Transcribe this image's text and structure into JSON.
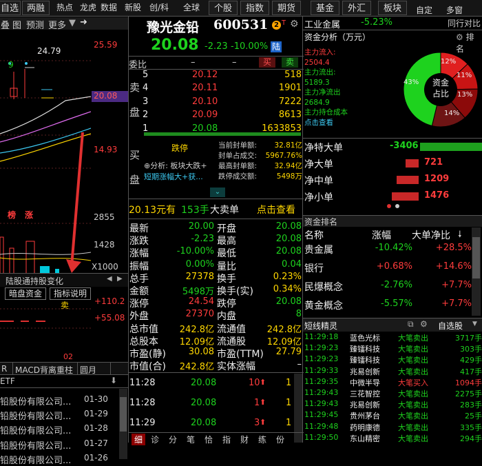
{
  "toolbar": {
    "items": [
      "自选",
      "两融",
      "热点",
      "龙虎",
      "数据",
      "新股",
      "创/科",
      "全球",
      "个股",
      "指数",
      "期货",
      "基金",
      "外汇",
      "板块",
      "自定",
      "多窗"
    ]
  },
  "left": {
    "tabs": [
      "叠",
      "图",
      "预测",
      "更多"
    ],
    "price_labels": [
      "25.59",
      "20.08",
      "14.93",
      "2855",
      "1428",
      "X1000"
    ],
    "high_label": "24.79",
    "bar_label": "9",
    "tags": [
      "榜",
      "涨"
    ],
    "tool_title": "陆股通持股变化",
    "tool_btns": [
      "暗盘资金",
      "指标说明"
    ],
    "sell_mark": "卖",
    "ind_top": "+110.2",
    "ind_bot": "+55.08",
    "date_label": "02",
    "ind_tabs": [
      "R",
      "MACD背离重柱",
      "圆月"
    ],
    "list_head": "ETF",
    "list": [
      {
        "name": "铅股份有限公司...",
        "date": "01-30"
      },
      {
        "name": "铅股份有限公司...",
        "date": "01-29"
      },
      {
        "name": "铅股份有限公司...",
        "date": "01-28"
      },
      {
        "name": "铅股份有限公司...",
        "date": "01-27"
      },
      {
        "name": "铅股份有限公司...",
        "date": "01-26"
      }
    ]
  },
  "stock": {
    "name": "豫光金铅",
    "code": "600531",
    "price": "20.08",
    "change": "-2.23",
    "pct": "-10.00%",
    "tag": "陆",
    "badge": "2",
    "t": "T"
  },
  "weibi": {
    "label": "委比",
    "v1": "–",
    "v2": "–",
    "buy": "买",
    "sell": "卖"
  },
  "sell_side": {
    "label": [
      "卖",
      "盘"
    ],
    "rows": [
      {
        "lvl": "5",
        "price": "20.12",
        "vol": "518"
      },
      {
        "lvl": "4",
        "price": "20.11",
        "vol": "1901"
      },
      {
        "lvl": "3",
        "price": "20.10",
        "vol": "7222"
      },
      {
        "lvl": "2",
        "price": "20.09",
        "vol": "8613"
      },
      {
        "lvl": "1",
        "price": "20.08",
        "vol": "1633853"
      }
    ]
  },
  "buy_side": {
    "label": [
      "买",
      "盘"
    ],
    "status": "跌停",
    "analysis": "⊕分析: 板块大跌+",
    "short": "短期涨幅大+获...",
    "seal": [
      {
        "k": "当前封单额:",
        "v": "32.81亿"
      },
      {
        "k": "封单占成交:",
        "v": "5967.76%"
      },
      {
        "k": "最高封单额:",
        "v": "32.94亿"
      },
      {
        "k": "跌停成交额:",
        "v": "5498万"
      }
    ]
  },
  "bigorder": {
    "price": "20.13元有",
    "vol": "153手",
    "kind": "大卖单",
    "link": "点击查看"
  },
  "quote": [
    {
      "k1": "最新",
      "v1": "20.00",
      "k2": "开盘",
      "v2": "20.08"
    },
    {
      "k1": "涨跌",
      "v1": "-2.23",
      "k2": "最高",
      "v2": "20.08"
    },
    {
      "k1": "涨幅",
      "v1": "-10.00%",
      "k2": "最低",
      "v2": "20.08"
    },
    {
      "k1": "振幅",
      "v1": "0.00%",
      "k2": "量比",
      "v2": "0.04"
    },
    {
      "k1": "总手",
      "v1": "27378",
      "k2": "换手",
      "v2": "0.23%"
    },
    {
      "k1": "金额",
      "v1": "5498万",
      "k2": "换手(实)",
      "v2": "0.34%"
    },
    {
      "k1": "涨停",
      "v1": "24.54",
      "k2": "跌停",
      "v2": "20.08"
    },
    {
      "k1": "外盘",
      "v1": "27370",
      "k2": "内盘",
      "v2": "8"
    },
    {
      "k1": "总市值",
      "v1": "242.8亿",
      "k2": "流通值",
      "v2": "242.8亿"
    },
    {
      "k1": "总股本",
      "v1": "12.09亿",
      "k2": "流通股",
      "v2": "12.09亿"
    },
    {
      "k1": "市盈(静)",
      "v1": "30.08",
      "k2": "市盈(TTM)",
      "v2": "27.79"
    },
    {
      "k1": "市值(合)",
      "v1": "242.8亿",
      "k2": "实体涨幅",
      "v2": "–"
    }
  ],
  "ticks": [
    {
      "t": "11:28",
      "p": "20.08",
      "v": "10",
      "n": "1"
    },
    {
      "t": "11:28",
      "p": "20.08",
      "v": "1",
      "n": "1"
    },
    {
      "t": "11:29",
      "p": "20.08",
      "v": "3",
      "n": "1"
    }
  ],
  "mid_tabs": [
    "细",
    "诊",
    "分",
    "笔",
    "恰",
    "指",
    "财",
    "练",
    "份"
  ],
  "sector": {
    "name": "工业金属",
    "pct": "-5.23%",
    "compare": "同行对比"
  },
  "fund": {
    "title": "资金分析（万元）",
    "rank": "排名",
    "items": [
      {
        "k": "主力流入:",
        "v": "2504.4"
      },
      {
        "k": "主力流出:",
        "v": "5189.3"
      },
      {
        "k": "主力净流出",
        "v": "2684.9"
      },
      {
        "k": "主力持仓成本",
        "v": ""
      }
    ],
    "link": "点击查看",
    "center": [
      "资金",
      "占比"
    ],
    "pcts": [
      "12%",
      "11%",
      "13%",
      "14%",
      "43%"
    ]
  },
  "flows": [
    {
      "k": "净特大单",
      "v": "-3406",
      "val": -3406
    },
    {
      "k": "净大单",
      "v": "721",
      "val": 721
    },
    {
      "k": "净中单",
      "v": "1209",
      "val": 1209
    },
    {
      "k": "净小单",
      "v": "1476",
      "val": 1476
    }
  ],
  "rank": {
    "title": "资金排名",
    "headers": [
      "名称",
      "涨幅",
      "大单净比"
    ],
    "rows": [
      {
        "n": "贵金属",
        "p": "-10.42%",
        "r": "+28.5%"
      },
      {
        "n": "银行",
        "p": "+0.68%",
        "r": "+14.6%"
      },
      {
        "n": "民爆概念",
        "p": "-2.76%",
        "r": "+7.7%"
      },
      {
        "n": "黄金概念",
        "p": "-5.57%",
        "r": "+7.7%"
      }
    ]
  },
  "sprite": {
    "title": "短线精灵",
    "pick": "自选股",
    "rows": [
      {
        "t": "11:29:18",
        "n": "蓝色光标",
        "a": "大笔卖出",
        "v": "3717手"
      },
      {
        "t": "11:29:23",
        "n": "臻镭科技",
        "a": "大笔卖出",
        "v": "303手"
      },
      {
        "t": "11:29:23",
        "n": "臻镭科技",
        "a": "大笔卖出",
        "v": "429手"
      },
      {
        "t": "11:29:33",
        "n": "兆易创新",
        "a": "大笔卖出",
        "v": "417手"
      },
      {
        "t": "11:29:35",
        "n": "中微半导",
        "a": "大笔买入",
        "v": "1094手"
      },
      {
        "t": "11:29:43",
        "n": "三花智控",
        "a": "大笔卖出",
        "v": "2275手"
      },
      {
        "t": "11:29:43",
        "n": "兆易创新",
        "a": "大笔卖出",
        "v": "283手"
      },
      {
        "t": "11:29:45",
        "n": "贵州茅台",
        "a": "大笔卖出",
        "v": "25手"
      },
      {
        "t": "11:29:48",
        "n": "药明康德",
        "a": "大笔卖出",
        "v": "335手"
      },
      {
        "t": "11:29:50",
        "n": "东山精密",
        "a": "大笔卖出",
        "v": "294手"
      }
    ]
  }
}
